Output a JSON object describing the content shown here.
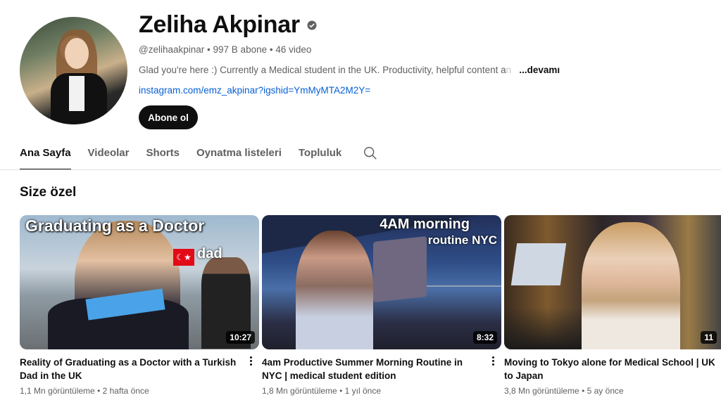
{
  "channel": {
    "name": "Zeliha Akpinar",
    "handle": "@zelihaakpinar",
    "subscribers": "997 B abone",
    "video_count": "46 video",
    "description_visible": "Glad you're here :) Currently a Medical student in the UK. Productivity, helpful content a",
    "description_faded": "n",
    "description_more": "...devamı",
    "link": "instagram.com/emz_akpinar?igshid=YmMyMTA2M2Y=",
    "subscribe_label": "Abone ol",
    "verified_icon": "verified-check-icon"
  },
  "tabs": [
    {
      "label": "Ana Sayfa",
      "active": true
    },
    {
      "label": "Videolar",
      "active": false
    },
    {
      "label": "Shorts",
      "active": false
    },
    {
      "label": "Oynatma listeleri",
      "active": false
    },
    {
      "label": "Topluluk",
      "active": false
    }
  ],
  "section_title": "Size özel",
  "videos": [
    {
      "title": "Reality of Graduating as a Doctor with a Turkish Dad in the UK",
      "duration": "10:27",
      "views": "1,1 Mn görüntüleme",
      "age": "2 hafta önce",
      "thumb_caption": "Graduating as a Doctor",
      "thumb_sub": "dad"
    },
    {
      "title": "4am Productive Summer Morning Routine in NYC | medical student edition",
      "duration": "8:32",
      "views": "1,8 Mn görüntüleme",
      "age": "1 yıl önce",
      "thumb_caption": "4AM morning",
      "thumb_sub": "routine NYC"
    },
    {
      "title": "Moving to Tokyo alone for Medical School | UK to Japan",
      "duration": "11",
      "views": "3,8 Mn görüntüleme",
      "age": "5 ay önce"
    }
  ],
  "meta_separator": "•",
  "colors": {
    "link": "#065fd4",
    "subscribe_bg": "#0f0f0f",
    "meta_text": "#606060"
  }
}
